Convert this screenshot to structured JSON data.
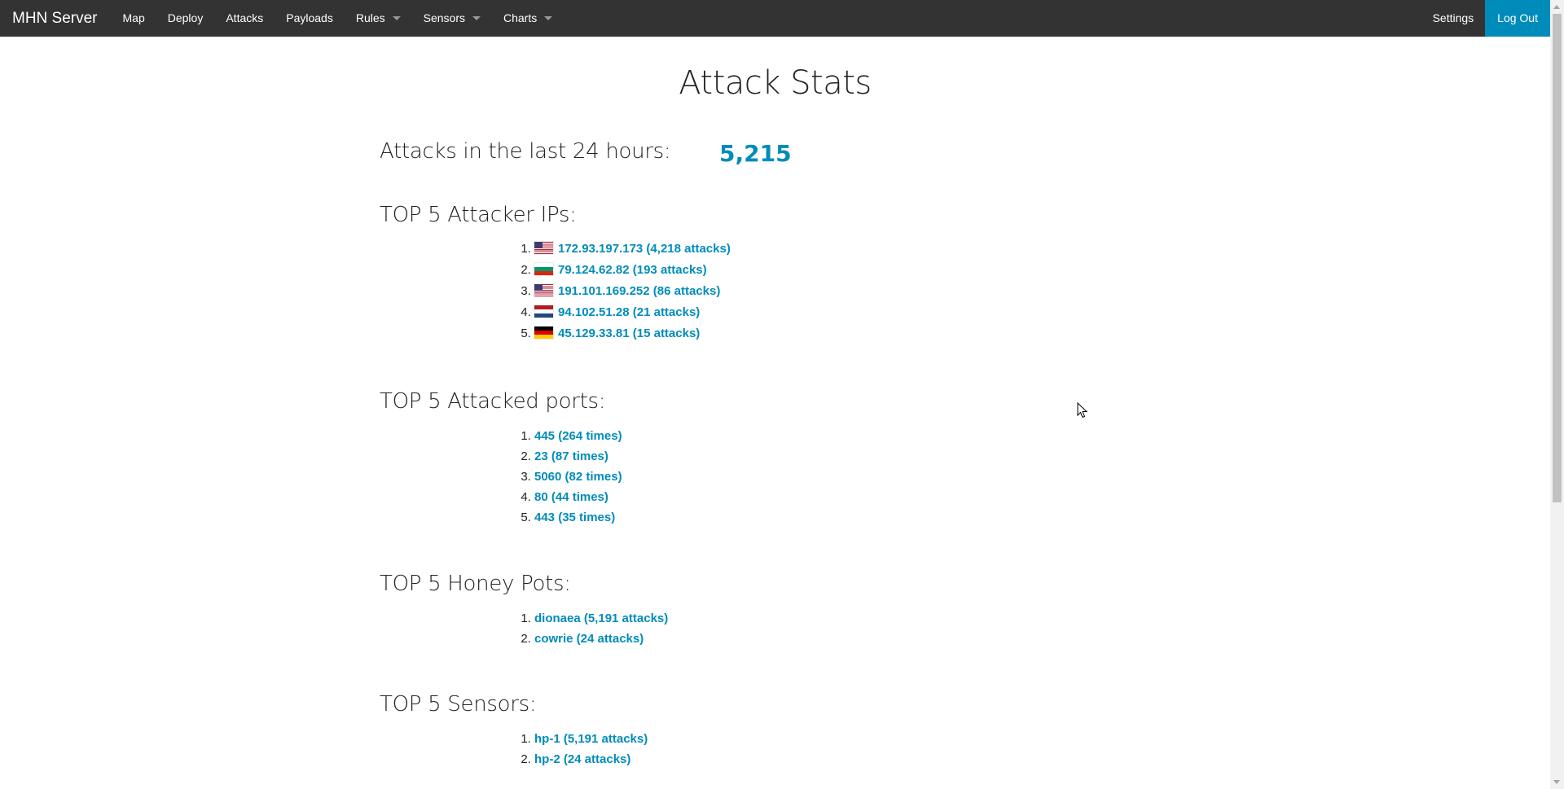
{
  "nav": {
    "brand": "MHN Server",
    "items": [
      {
        "label": "Map",
        "dropdown": false
      },
      {
        "label": "Deploy",
        "dropdown": false
      },
      {
        "label": "Attacks",
        "dropdown": false
      },
      {
        "label": "Payloads",
        "dropdown": false
      },
      {
        "label": "Rules",
        "dropdown": true
      },
      {
        "label": "Sensors",
        "dropdown": true
      },
      {
        "label": "Charts",
        "dropdown": true
      }
    ],
    "settings": "Settings",
    "logout": "Log Out"
  },
  "colors": {
    "navbar": "#333333",
    "accent": "#008cba",
    "text": "#222222"
  },
  "page": {
    "title": "Attack Stats",
    "attacks_label": "Attacks in the last 24 hours:",
    "attacks_count": "5,215",
    "top_ips_heading": "TOP 5 Attacker IPs:",
    "top_ips": [
      {
        "flag": "us",
        "text": "172.93.197.173 (4,218 attacks)"
      },
      {
        "flag": "bg",
        "text": "79.124.62.82 (193 attacks)"
      },
      {
        "flag": "us",
        "text": "191.101.169.252 (86 attacks)"
      },
      {
        "flag": "nl",
        "text": "94.102.51.28 (21 attacks)"
      },
      {
        "flag": "de",
        "text": "45.129.33.81 (15 attacks)"
      }
    ],
    "top_ports_heading": "TOP 5 Attacked ports:",
    "top_ports": [
      "445 (264 times)",
      "23 (87 times)",
      "5060 (82 times)",
      "80 (44 times)",
      "443 (35 times)"
    ],
    "top_pots_heading": "TOP 5 Honey Pots:",
    "top_pots": [
      "dionaea (5,191 attacks)",
      "cowrie (24 attacks)"
    ],
    "top_sensors_heading": "TOP 5 Sensors:",
    "top_sensors": [
      "hp-1 (5,191 attacks)",
      "hp-2 (24 attacks)"
    ]
  }
}
